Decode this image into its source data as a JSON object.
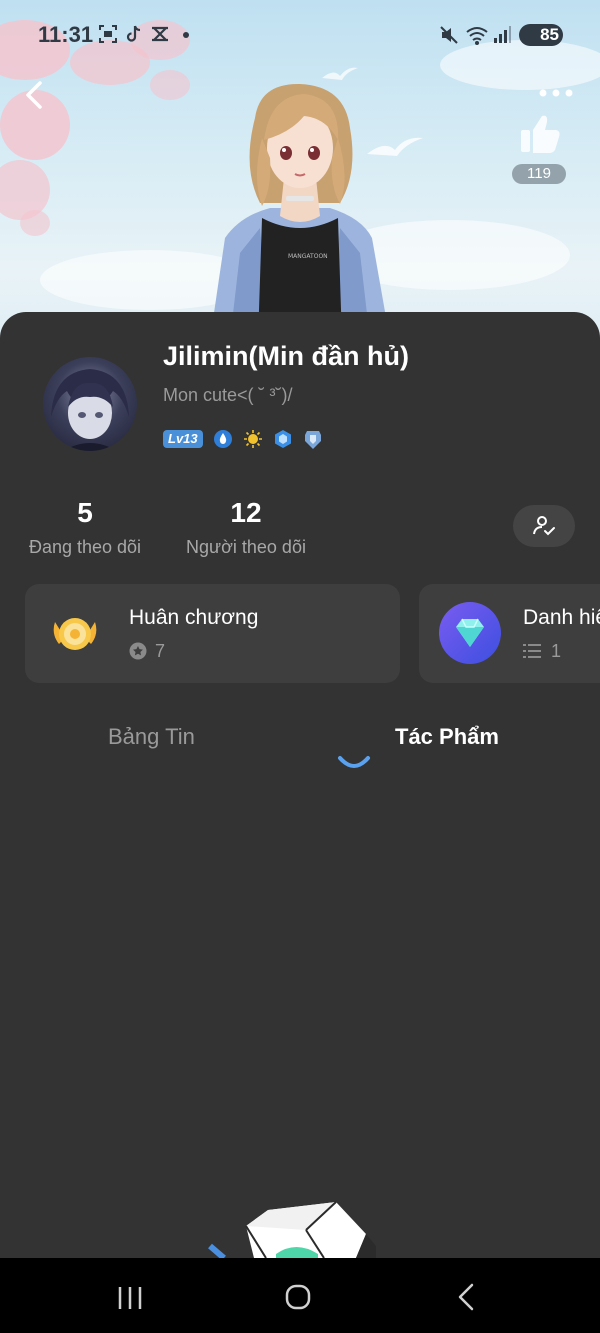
{
  "status_bar": {
    "time": "11:31",
    "battery": "85",
    "icons": [
      "screenshot-icon",
      "tiktok-icon",
      "capcut-icon",
      "dot-icon",
      "mute-icon",
      "wifi-icon",
      "signal-icon",
      "battery-icon"
    ]
  },
  "header": {
    "like_count": "119"
  },
  "profile": {
    "username": "Jilimin(Min đần hủ)",
    "bio": "Mon cute<( ˘ ³˘)/",
    "level": "Lv13",
    "badges": [
      "water-drop-badge",
      "sun-badge",
      "hexagon-badge",
      "shield-badge"
    ]
  },
  "stats": {
    "following_count": "5",
    "following_label": "Đang theo dõi",
    "followers_count": "12",
    "followers_label": "Người theo dõi"
  },
  "tiles": {
    "medals_title": "Huân chương",
    "medals_count": "7",
    "titles_title": "Danh hiệu",
    "titles_count": "1"
  },
  "tabs": {
    "feed": "Bảng Tin",
    "works": "Tác Phẩm",
    "active": "works"
  },
  "colors": {
    "card_bg": "#333333",
    "tile_bg": "#3e3e3e",
    "accent_blue": "#4a90d9",
    "spinner": "#5aa2f0"
  }
}
